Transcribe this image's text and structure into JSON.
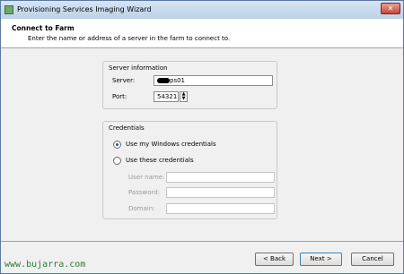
{
  "window": {
    "title": "Provisioning Services Imaging Wizard",
    "close_symbol": "✕"
  },
  "header": {
    "title": "Connect to Farm",
    "subtitle": "Enter the name or address of a server in the farm to connect to."
  },
  "server_info": {
    "legend": "Server information",
    "server_label": "Server:",
    "server_value": "ps01",
    "port_label": "Port:",
    "port_value": "54321",
    "spin_up": "▲",
    "spin_down": "▼"
  },
  "credentials": {
    "legend": "Credentials",
    "option_windows": "Use my Windows credentials",
    "option_these": "Use these credentials",
    "selected": "windows",
    "username_label": "User name:",
    "password_label": "Password:",
    "domain_label": "Domain:",
    "username_value": "",
    "password_value": "",
    "domain_value": ""
  },
  "buttons": {
    "back": "< Back",
    "next": "Next >",
    "cancel": "Cancel"
  },
  "watermark": "www.bujarra.com",
  "colors": {
    "titlebar": "#bcd2e8",
    "close": "#c7473a",
    "radio_dot": "#1f4f9a",
    "watermark": "#2e7d32"
  }
}
